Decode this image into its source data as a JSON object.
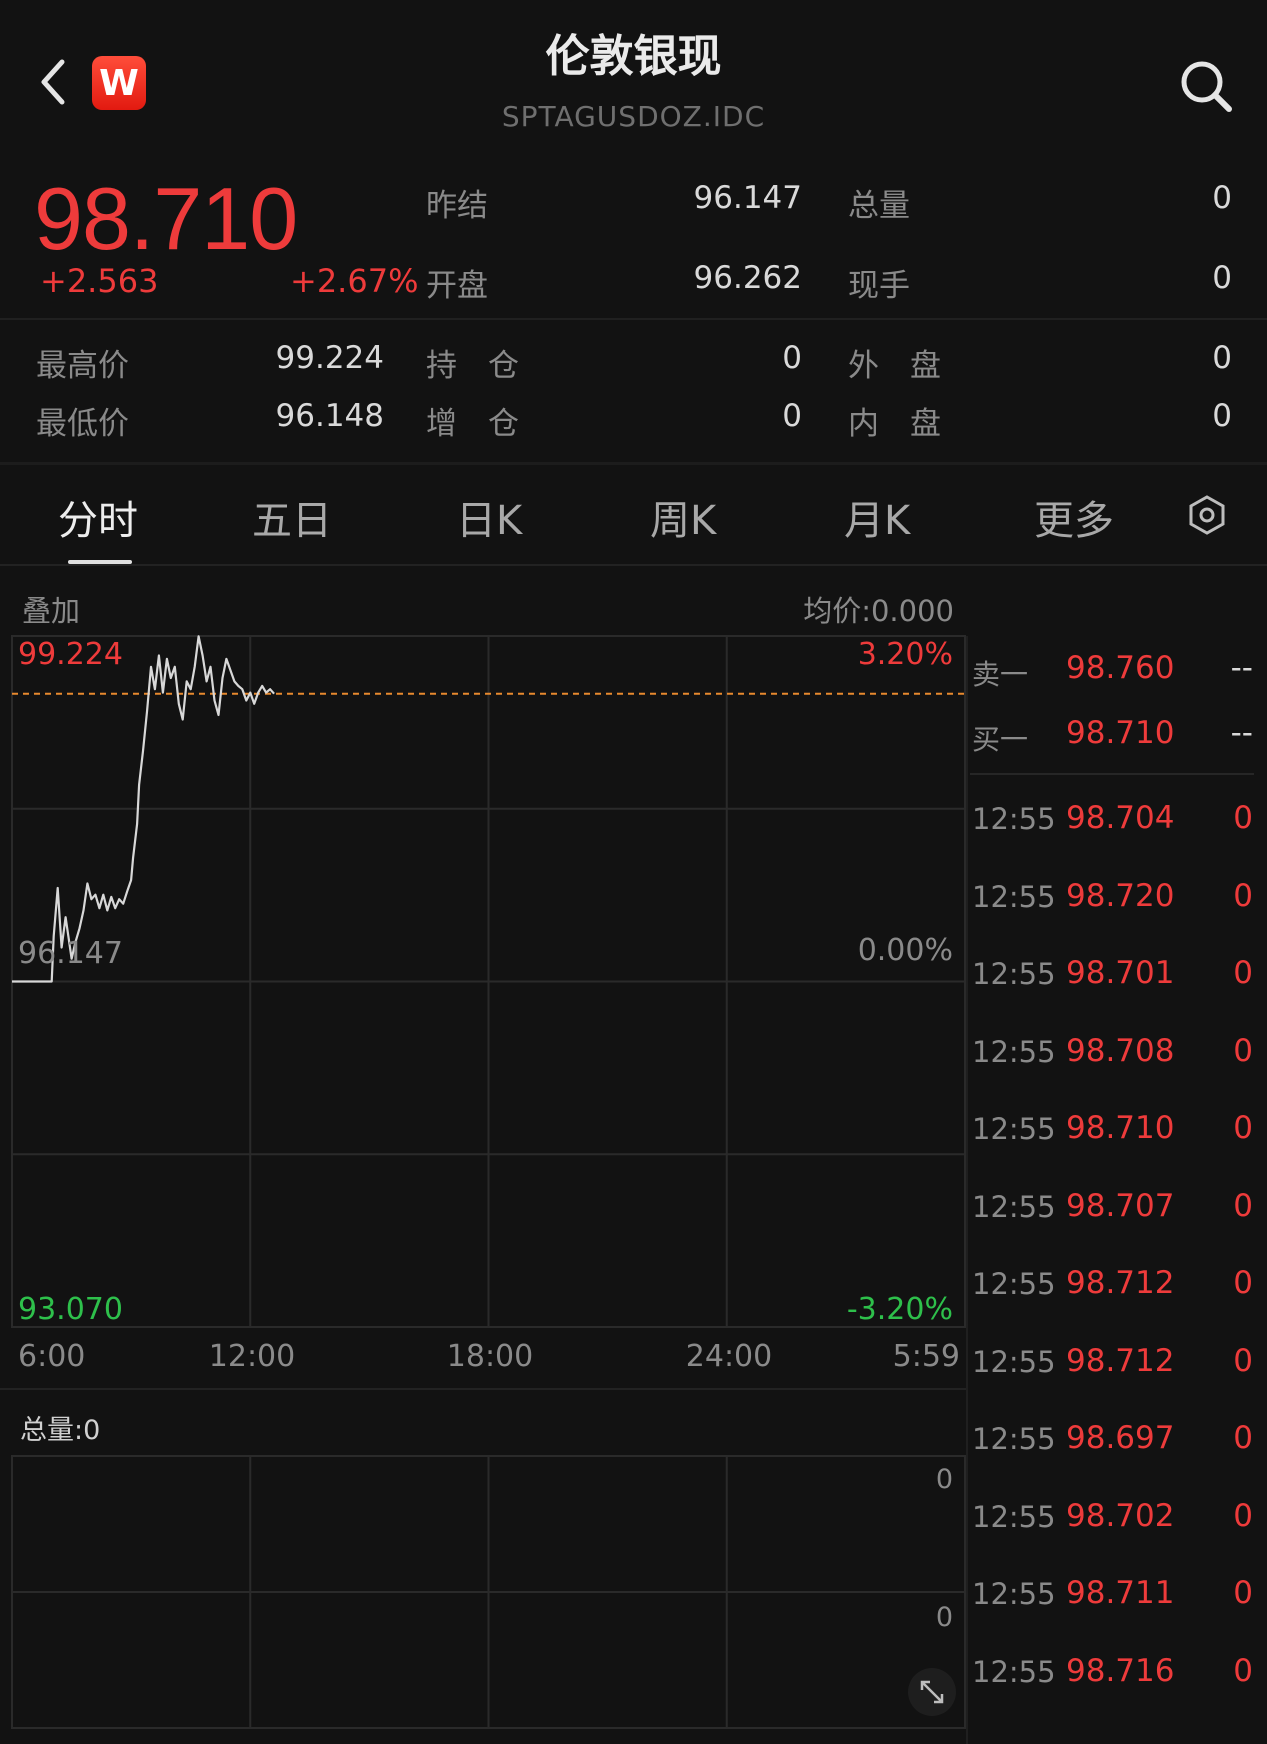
{
  "header": {
    "title": "伦敦银现",
    "code": "SPTAGUSDOZ.IDC",
    "logo_text": "W"
  },
  "quote": {
    "price": "98.710",
    "change": "+2.563",
    "change_pct": "+2.67%",
    "fields": [
      {
        "label": "昨结",
        "value": "96.147"
      },
      {
        "label": "开盘",
        "value": "96.262"
      },
      {
        "label": "总量",
        "value": "0"
      },
      {
        "label": "现手",
        "value": "0"
      },
      {
        "label": "最高价",
        "value": "99.224"
      },
      {
        "label": "最低价",
        "value": "96.148"
      },
      {
        "label": "持　仓",
        "value": "0"
      },
      {
        "label": "增　仓",
        "value": "0"
      },
      {
        "label": "外　盘",
        "value": "0"
      },
      {
        "label": "内　盘",
        "value": "0"
      }
    ]
  },
  "tabs": [
    "分时",
    "五日",
    "日K",
    "周K",
    "月K",
    "更多"
  ],
  "chart": {
    "overlay_label": "叠加",
    "avg_label": "均价:0.000",
    "vol_label": "总量:0",
    "vol_ticks": [
      "0",
      "0"
    ]
  },
  "chart_data": {
    "type": "line",
    "title": "",
    "xlabel": "",
    "ylabel": "",
    "x_ticks": [
      "6:00",
      "12:00",
      "18:00",
      "24:00",
      "5:59"
    ],
    "y_left_ticks": [
      "99.224",
      "96.147",
      "93.070"
    ],
    "y_right_ticks": [
      "3.20%",
      "0.00%",
      "-3.20%"
    ],
    "ylim": [
      93.07,
      99.224
    ],
    "prev_settle": 96.147,
    "current_price": 98.71,
    "series": [
      {
        "values": [
          [
            6.0,
            96.147
          ],
          [
            7.0,
            96.147
          ],
          [
            7.05,
            96.55
          ],
          [
            7.15,
            96.98
          ],
          [
            7.25,
            96.45
          ],
          [
            7.35,
            96.72
          ],
          [
            7.5,
            96.35
          ],
          [
            7.6,
            96.5
          ],
          [
            7.7,
            96.62
          ],
          [
            7.8,
            96.78
          ],
          [
            7.9,
            97.02
          ],
          [
            8.0,
            96.88
          ],
          [
            8.1,
            96.92
          ],
          [
            8.2,
            96.8
          ],
          [
            8.3,
            96.92
          ],
          [
            8.4,
            96.78
          ],
          [
            8.5,
            96.9
          ],
          [
            8.6,
            96.8
          ],
          [
            8.7,
            96.88
          ],
          [
            8.8,
            96.84
          ],
          [
            8.9,
            96.95
          ],
          [
            9.0,
            97.05
          ],
          [
            9.05,
            97.25
          ],
          [
            9.15,
            97.55
          ],
          [
            9.2,
            97.9
          ],
          [
            9.3,
            98.2
          ],
          [
            9.4,
            98.55
          ],
          [
            9.5,
            98.95
          ],
          [
            9.6,
            98.75
          ],
          [
            9.7,
            99.05
          ],
          [
            9.8,
            98.72
          ],
          [
            9.9,
            99.02
          ],
          [
            10.0,
            98.85
          ],
          [
            10.1,
            98.95
          ],
          [
            10.2,
            98.62
          ],
          [
            10.3,
            98.48
          ],
          [
            10.4,
            98.82
          ],
          [
            10.5,
            98.75
          ],
          [
            10.6,
            98.95
          ],
          [
            10.7,
            99.22
          ],
          [
            10.8,
            99.05
          ],
          [
            10.9,
            98.82
          ],
          [
            11.0,
            98.95
          ],
          [
            11.1,
            98.65
          ],
          [
            11.2,
            98.52
          ],
          [
            11.3,
            98.85
          ],
          [
            11.4,
            99.02
          ],
          [
            11.5,
            98.92
          ],
          [
            11.6,
            98.82
          ],
          [
            11.7,
            98.78
          ],
          [
            11.8,
            98.75
          ],
          [
            11.9,
            98.65
          ],
          [
            12.0,
            98.72
          ],
          [
            12.1,
            98.62
          ],
          [
            12.2,
            98.72
          ],
          [
            12.3,
            98.78
          ],
          [
            12.4,
            98.72
          ],
          [
            12.5,
            98.75
          ],
          [
            12.6,
            98.71
          ]
        ]
      }
    ]
  },
  "right_panel": {
    "sell_label": "卖一",
    "sell_price": "98.760",
    "sell_qty": "--",
    "buy_label": "买一",
    "buy_price": "98.710",
    "buy_qty": "--",
    "ticks": [
      {
        "time": "12:55",
        "price": "98.704",
        "qty": "0"
      },
      {
        "time": "12:55",
        "price": "98.720",
        "qty": "0"
      },
      {
        "time": "12:55",
        "price": "98.701",
        "qty": "0"
      },
      {
        "time": "12:55",
        "price": "98.708",
        "qty": "0"
      },
      {
        "time": "12:55",
        "price": "98.710",
        "qty": "0"
      },
      {
        "time": "12:55",
        "price": "98.707",
        "qty": "0"
      },
      {
        "time": "12:55",
        "price": "98.712",
        "qty": "0"
      },
      {
        "time": "12:55",
        "price": "98.712",
        "qty": "0"
      },
      {
        "time": "12:55",
        "price": "98.697",
        "qty": "0"
      },
      {
        "time": "12:55",
        "price": "98.702",
        "qty": "0"
      },
      {
        "time": "12:55",
        "price": "98.711",
        "qty": "0"
      },
      {
        "time": "12:55",
        "price": "98.716",
        "qty": "0"
      }
    ]
  },
  "colors": {
    "up": "#ee3b3b",
    "down": "#2ec04b",
    "line": "#d8d8d8",
    "ref_line": "#e8892e",
    "grid": "#2a2a2a"
  },
  "icons": [
    "back-arrow-icon",
    "search-icon",
    "settings-hexagon-icon",
    "expand-icon"
  ]
}
